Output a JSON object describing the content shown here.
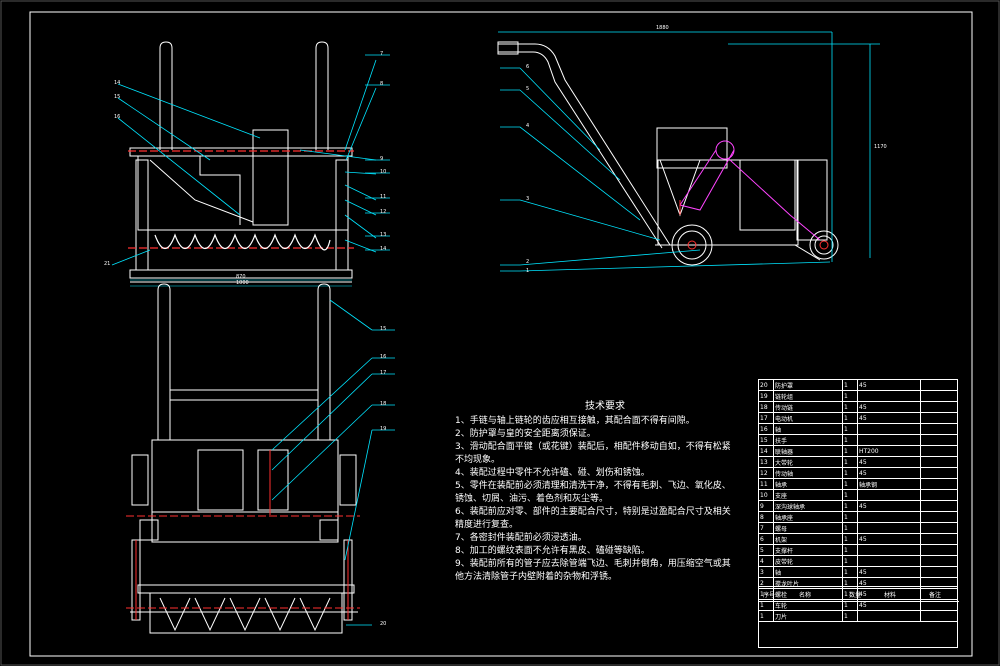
{
  "tech_notes": {
    "title": "技术要求",
    "items": [
      "1、手链与轴上链轮的齿应相互接触，其配合面不得有间隙。",
      "2、防护罩与皇的安全距离须保证。",
      "3、滑动配合面平键（或花键）装配后，相配件移动自如，不得有松紧",
      "   不均现象。",
      "4、装配过程中零件不允许磕、碰、划伤和锈蚀。",
      "5、零件在装配前必须清理和清洗干净，不得有毛刺、飞边、氧化皮、",
      "   锈蚀、切屑、油污、着色剂和灰尘等。",
      "6、装配前应对零、部件的主要配合尺寸，特别是过盈配合尺寸及相关",
      "   精度进行复查。",
      "7、各密封件装配前必须浸透油。",
      "8、加工的螺纹表面不允许有黑皮、磕碰等缺陷。",
      "9、装配前所有的管子应去除管端飞边、毛刺并倒角，用压缩空气或其",
      "   他方法清除管子内壁附着的杂物和浮锈。"
    ]
  },
  "bom_rows": [
    [
      "20",
      "防护罩",
      "1",
      "45"
    ],
    [
      "19",
      "链轮组",
      "1",
      ""
    ],
    [
      "18",
      "传动链",
      "1",
      "45"
    ],
    [
      "17",
      "电动机",
      "1",
      "45"
    ],
    [
      "16",
      "轴",
      "1",
      ""
    ],
    [
      "15",
      "扶手",
      "1",
      ""
    ],
    [
      "14",
      "联轴器",
      "1",
      "HT200"
    ],
    [
      "13",
      "大带轮",
      "1",
      "45"
    ],
    [
      "12",
      "传动轴",
      "1",
      "45"
    ],
    [
      "11",
      "轴承",
      "1",
      "轴承钢"
    ],
    [
      "10",
      "支座",
      "1",
      ""
    ],
    [
      "9",
      "深沟球轴承",
      "1",
      "45"
    ],
    [
      "8",
      "轴承座",
      "1",
      ""
    ],
    [
      "7",
      "螺母",
      "1",
      ""
    ],
    [
      "6",
      "机架",
      "1",
      "45"
    ],
    [
      "5",
      "支撑杆",
      "1",
      ""
    ],
    [
      "4",
      "皮带轮",
      "1",
      ""
    ],
    [
      "3",
      "轴",
      "1",
      "45"
    ],
    [
      "2",
      "搅龙叶片",
      "1",
      "45"
    ],
    [
      "1",
      "螺栓",
      "1",
      "45"
    ],
    [
      "1",
      "车轮",
      "1",
      "45"
    ],
    [
      "1",
      "刀片",
      "1",
      ""
    ]
  ],
  "bom_footer": [
    "序号",
    "名称",
    "数量",
    "材料",
    "单件",
    "总计",
    "备注"
  ],
  "dimension_labels": [
    "1880",
    "1170",
    "870",
    "1000"
  ],
  "part_numbers_left": [
    "14",
    "15",
    "16",
    "21",
    "15"
  ],
  "part_numbers_right": [
    "7",
    "8",
    "9",
    "10",
    "11",
    "12",
    "13",
    "14",
    "15",
    "16",
    "17",
    "18",
    "19",
    "20",
    "21"
  ],
  "part_numbers_side": [
    "6",
    "5",
    "4",
    "3",
    "2",
    "1"
  ]
}
